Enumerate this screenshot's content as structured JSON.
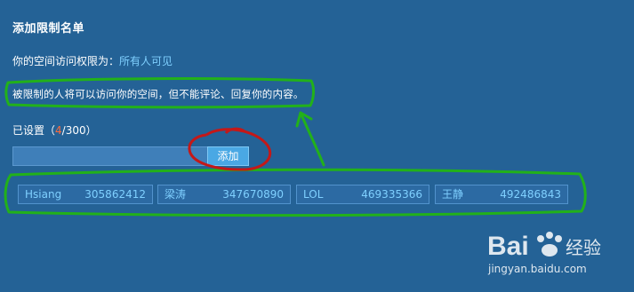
{
  "header": {
    "title": "添加限制名单"
  },
  "permission": {
    "prefix": "你的空间访问权限为：",
    "value": "所有人可见"
  },
  "description": "被限制的人将可以访问你的空间，但不能评论、回复你的内容。",
  "count": {
    "label": "已设置（",
    "current": "4",
    "sep": "/300）"
  },
  "add_form": {
    "input_value": "",
    "button_label": "添加"
  },
  "restricted_list": [
    {
      "name": "Hsiang",
      "qq": "305862412"
    },
    {
      "name": "梁涛",
      "qq": "347670890"
    },
    {
      "name": "LOL",
      "qq": "469335366"
    },
    {
      "name": "王静",
      "qq": "492486843"
    }
  ],
  "watermark": {
    "brand": "Bai 经验",
    "url": "jingyan.baidu.com"
  },
  "colors": {
    "background": "#246296",
    "link": "#7fd0ff",
    "count_accent": "#ff6a3a",
    "annotation_green": "#22b11a",
    "annotation_red": "#c41818"
  }
}
